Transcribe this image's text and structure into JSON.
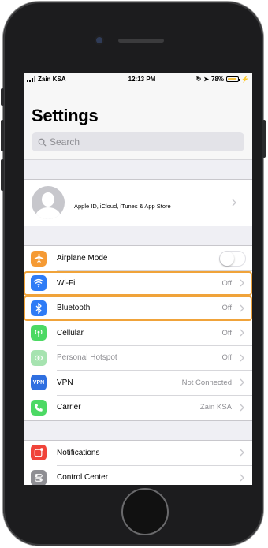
{
  "status_bar": {
    "carrier": "Zain KSA",
    "time": "12:13 PM",
    "battery_text": "78%"
  },
  "header": {
    "title": "Settings",
    "search_placeholder": "Search"
  },
  "apple_id": {
    "label": "Apple ID, iCloud, iTunes & App Store"
  },
  "connectivity": [
    {
      "label": "Airplane Mode",
      "value": "",
      "icon": "airplane-icon",
      "color": "#f59a34",
      "control": "toggle"
    },
    {
      "label": "Wi-Fi",
      "value": "Off",
      "icon": "wifi-icon",
      "color": "#2f7cf6",
      "control": "chevron",
      "highlighted": true
    },
    {
      "label": "Bluetooth",
      "value": "Off",
      "icon": "bluetooth-icon",
      "color": "#2f7cf6",
      "control": "chevron",
      "highlighted": true
    },
    {
      "label": "Cellular",
      "value": "Off",
      "icon": "cellular-icon",
      "color": "#4cd964",
      "control": "chevron"
    },
    {
      "label": "Personal Hotspot",
      "value": "Off",
      "icon": "hotspot-icon",
      "color": "#a6e3b0",
      "control": "chevron",
      "dimmed": true
    },
    {
      "label": "VPN",
      "value": "Not Connected",
      "icon": "vpn-icon",
      "icon_text": "VPN",
      "color": "#2f6fe0",
      "control": "chevron"
    },
    {
      "label": "Carrier",
      "value": "Zain KSA",
      "icon": "phone-icon",
      "color": "#4cd964",
      "control": "chevron"
    }
  ],
  "system": [
    {
      "label": "Notifications",
      "icon": "notifications-icon",
      "color": "#f0443a"
    },
    {
      "label": "Control Center",
      "icon": "control-center-icon",
      "color": "#8e8e93"
    }
  ],
  "colors": {
    "highlight": "#f0a33a",
    "chevron": "#c7c7cc"
  }
}
